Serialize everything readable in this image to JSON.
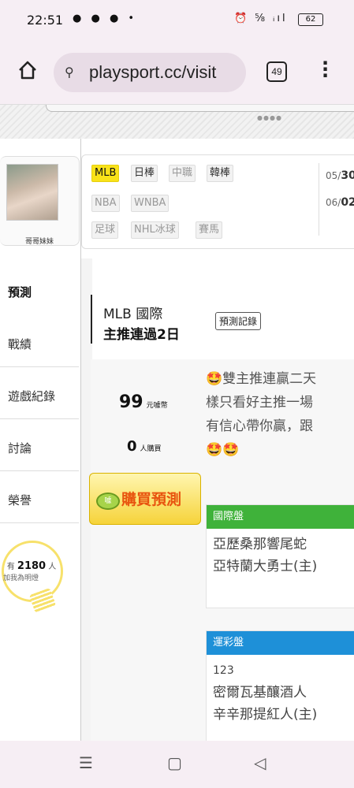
{
  "status_bar": {
    "time": "22:51",
    "left_icons": "● ● ● •",
    "right_icons": "⏰ ⅝ ᵢıl",
    "battery": "62"
  },
  "browser": {
    "url": "playsport.cc/visit",
    "tab_count": "49"
  },
  "profile": {
    "name": "哥哥妹妹"
  },
  "sidebar": {
    "items": [
      {
        "label": "預測"
      },
      {
        "label": "戰績"
      },
      {
        "label": "遊戲紀錄"
      },
      {
        "label": "討論"
      },
      {
        "label": "榮譽"
      }
    ],
    "fans_prefix": "有",
    "fans_count": "2180",
    "fans_suffix": "人",
    "fans_sub": "加我為明燈"
  },
  "filters": {
    "row1": [
      "MLB",
      "日棒",
      "中職",
      "韓棒"
    ],
    "row2": [
      "NBA",
      "WNBA"
    ],
    "row3": [
      "足球",
      "NHL冰球",
      "賽馬"
    ],
    "selected": "MLB"
  },
  "dates": [
    {
      "month": "05/",
      "day": "30"
    },
    {
      "month": "06/",
      "day": "02"
    }
  ],
  "title": {
    "league": "MLB 國際",
    "streak": "主推連過2日",
    "record_button": "預測記錄"
  },
  "purchase": {
    "price": "99",
    "price_unit": "元噱幣",
    "buyers": "0",
    "buyers_unit": "人購買",
    "buy_icon": "噱",
    "buy_button": "購買預測"
  },
  "description": {
    "line1": "🤩雙主推連贏二天",
    "line2": "樣只看好主推一場",
    "line3": "有信心帶你贏，跟",
    "line4": "🤩🤩"
  },
  "markets": [
    {
      "name": "國際盤",
      "code": "",
      "team1": "亞歷桑那響尾蛇",
      "team2": "亞特蘭大勇士(主)"
    },
    {
      "name": "運彩盤",
      "code": "123",
      "team1": "密爾瓦基釀酒人",
      "team2": "辛辛那提紅人(主)"
    }
  ],
  "colors": {
    "selected_chip": "#f9e219",
    "intl_market": "#3fb23a",
    "lottery_market": "#1e90d8",
    "buy_text": "#e8540f"
  }
}
